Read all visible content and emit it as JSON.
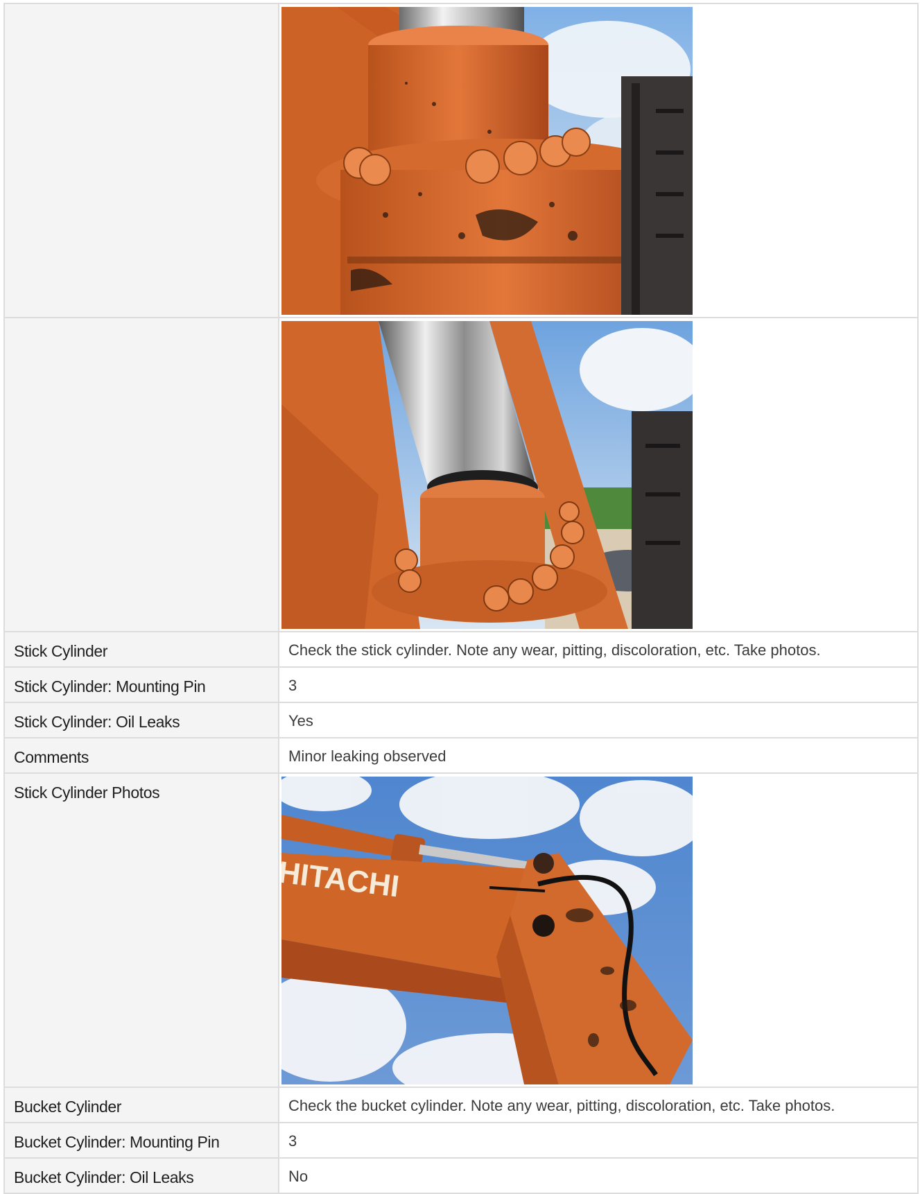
{
  "rows": [
    {
      "type": "photo",
      "label": "",
      "photo": "hydraulic-cylinder-base-photo"
    },
    {
      "type": "photo",
      "label": "",
      "photo": "hydraulic-cylinder-rod-photo"
    },
    {
      "type": "text",
      "label": "Stick Cylinder",
      "value": "Check the stick cylinder. Note any wear, pitting, discoloration, etc. Take photos."
    },
    {
      "type": "text",
      "label": "Stick Cylinder: Mounting Pin",
      "value": "3"
    },
    {
      "type": "text",
      "label": "Stick Cylinder: Oil Leaks",
      "value": "Yes"
    },
    {
      "type": "text",
      "label": "Comments",
      "value": "Minor leaking observed"
    },
    {
      "type": "photo",
      "label": "Stick Cylinder Photos",
      "photo": "stick-arm-photo",
      "photo_text": "HITACHI"
    },
    {
      "type": "text",
      "label": "Bucket Cylinder",
      "value": "Check the bucket cylinder. Note any wear, pitting, discoloration, etc. Take photos."
    },
    {
      "type": "text",
      "label": "Bucket Cylinder: Mounting Pin",
      "value": "3"
    },
    {
      "type": "text",
      "label": "Bucket Cylinder: Oil Leaks",
      "value": "No"
    }
  ],
  "colors": {
    "label_bg": "#f4f4f4",
    "border": "#dcdcdc",
    "machine_orange": "#d8692c",
    "sky": "#5b8fd4"
  }
}
